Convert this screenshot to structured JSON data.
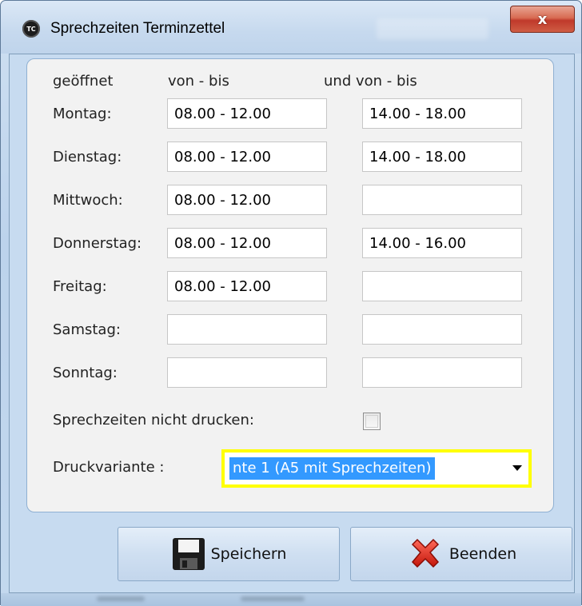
{
  "window": {
    "title": "Sprechzeiten Terminzettel",
    "icon_text": "TC",
    "close_symbol": "x"
  },
  "headers": {
    "col_day": "geöffnet",
    "col_first": "von - bis",
    "col_second": "und von - bis"
  },
  "days": [
    {
      "label": "Montag:",
      "first": "08.00 - 12.00",
      "second": "14.00 - 18.00"
    },
    {
      "label": "Dienstag:",
      "first": "08.00 - 12.00",
      "second": "14.00 - 18.00"
    },
    {
      "label": "Mittwoch:",
      "first": "08.00 - 12.00",
      "second": ""
    },
    {
      "label": "Donnerstag:",
      "first": "08.00 - 12.00",
      "second": "14.00 - 16.00"
    },
    {
      "label": "Freitag:",
      "first": "08.00 - 12.00",
      "second": ""
    },
    {
      "label": "Samstag:",
      "first": "",
      "second": ""
    },
    {
      "label": "Sonntag:",
      "first": "",
      "second": ""
    }
  ],
  "options": {
    "no_print_label": "Sprechzeiten nicht drucken:",
    "no_print_checked": false,
    "print_variant_label": "Druckvariante :",
    "print_variant_value": "nte 1  (A5 mit Sprechzeiten)"
  },
  "buttons": {
    "save_label": "Speichern",
    "save_icon": "floppy-disk-icon",
    "exit_label": "Beenden",
    "exit_icon": "red-x-icon"
  },
  "colors": {
    "focus_highlight": "#ffff00",
    "selection": "#3399ff",
    "close_button": "#c0392b"
  }
}
